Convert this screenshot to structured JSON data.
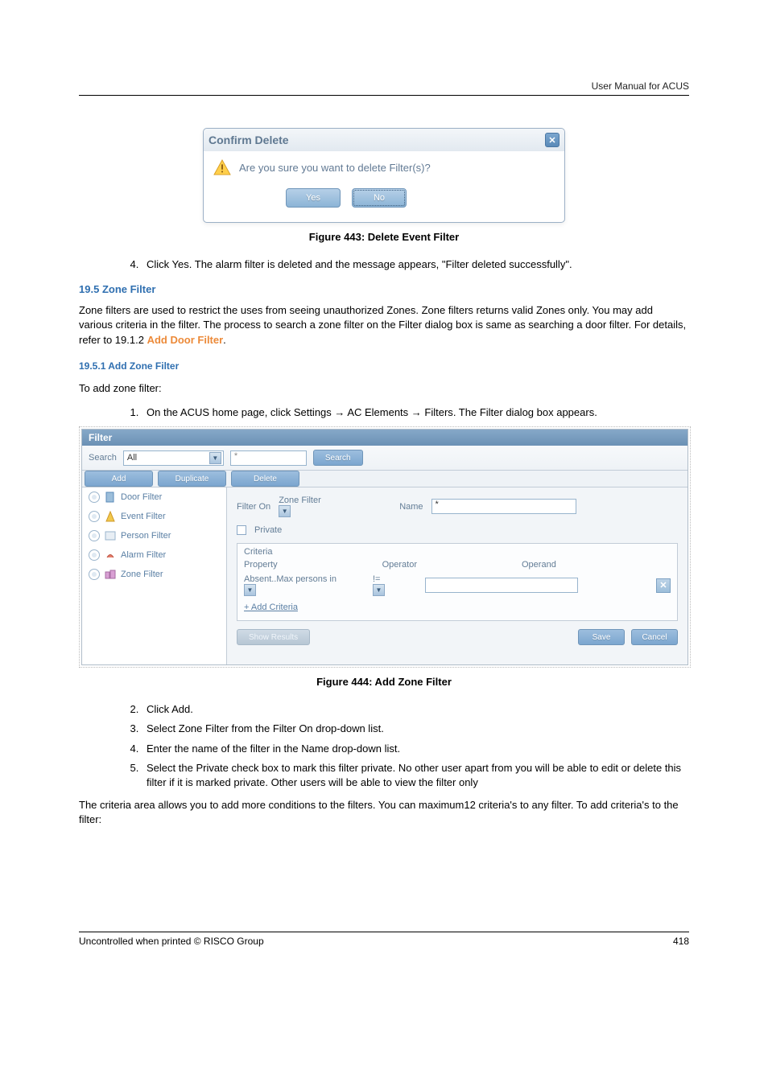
{
  "header": {
    "right": "User Manual for ACUS"
  },
  "confirm_dialog": {
    "title": "Confirm Delete",
    "message": "Are you sure you want to delete Filter(s)?",
    "yes": "Yes",
    "no": "No"
  },
  "captions": {
    "fig443": "Figure 443: Delete Event Filter",
    "fig444": "Figure 444: Add Zone Filter"
  },
  "steps_top": {
    "s4_part1": "Click ",
    "s4_bold1": "Yes",
    "s4_part2": ". The alarm filter is deleted and the message appears, \"",
    "s4_boldit": "Filter deleted successfully",
    "s4_part3": "\"."
  },
  "section_19_5": {
    "heading_no": "19.5",
    "heading_text": "Zone Filter",
    "para1_a": "Zone filters are used to restrict the uses from seeing unauthorized Zones. Zone filters returns valid Zones only. You may add various criteria in the filter. The process to search a zone filter on the Filter dialog box is same as searching a door filter. For details, refer to 19.1.2 ",
    "para1_link": "Add Door Filter",
    "para1_b": "."
  },
  "section_19_5_1": {
    "heading": "19.5.1   Add Zone Filter",
    "intro": "To add zone filter:",
    "step1_a": "On the ACUS home page, click ",
    "step1_b": "Settings",
    "step1_c": " → ",
    "step1_d": "AC Elements",
    "step1_e": " → ",
    "step1_f": "Filters",
    "step1_g": ". The ",
    "step1_h": "Filter",
    "step1_i": " dialog box appears."
  },
  "filter_window": {
    "title": "Filter",
    "search_label": "Search",
    "search_dd": "All",
    "search_placeholder": "*",
    "search_btn": "Search",
    "tabs": {
      "add": "Add",
      "duplicate": "Duplicate",
      "delete": "Delete"
    },
    "left_items": [
      {
        "label": "Door Filter"
      },
      {
        "label": "Event Filter"
      },
      {
        "label": "Person Filter"
      },
      {
        "label": "Alarm Filter"
      },
      {
        "label": "Zone Filter"
      }
    ],
    "right": {
      "filter_on_label": "Filter On",
      "filter_on_value": "Zone Filter",
      "name_label": "Name",
      "name_value": "*",
      "private_label": "Private",
      "criteria_legend": "Criteria",
      "col_property": "Property",
      "col_operator": "Operator",
      "col_operand": "Operand",
      "property_value": "Absent..Max persons in",
      "operator_value": "!=",
      "operand_value": "",
      "add_criteria": "+ Add Criteria",
      "show_results": "Show Results",
      "save": "Save",
      "cancel": "Cancel"
    }
  },
  "steps_bottom": {
    "s2_a": "Click ",
    "s2_b": "Add",
    "s2_c": ".",
    "s3_a": "Select ",
    "s3_b": "Zone Filter",
    "s3_c": " from the ",
    "s3_d": "Filter On",
    "s3_e": " drop-down list.",
    "s4_a": "Enter the name of the filter in the ",
    "s4_b": "Name",
    "s4_c": " drop-down list.",
    "s5_a": "Select the ",
    "s5_b": "Private",
    "s5_c": " check box to mark this filter private. No other user apart from you will be able to edit or delete this filter if it is marked private. Other users will be able to view the filter only"
  },
  "tail_para": "The criteria area allows you to add more conditions to the filters. You can maximum12 criteria's to any filter. To add criteria's to the filter:",
  "footer": {
    "left": "Uncontrolled when printed © RISCO Group",
    "right": "418"
  }
}
